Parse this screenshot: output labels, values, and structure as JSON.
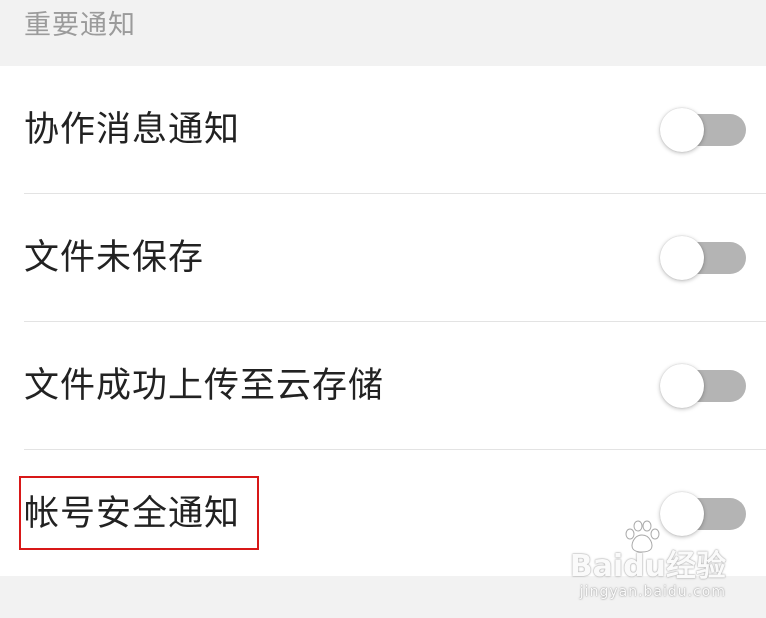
{
  "section": {
    "title": "重要通知"
  },
  "notifications": [
    {
      "label": "协作消息通知",
      "enabled": false
    },
    {
      "label": "文件未保存",
      "enabled": false
    },
    {
      "label": "文件成功上传至云存储",
      "enabled": false
    },
    {
      "label": "帐号安全通知",
      "enabled": false
    }
  ],
  "watermark": {
    "logo": "Baidu经验",
    "url": "jingyan.baidu.com"
  },
  "colors": {
    "highlight": "#d81818",
    "toggle_off_track": "#b4b4b4"
  }
}
